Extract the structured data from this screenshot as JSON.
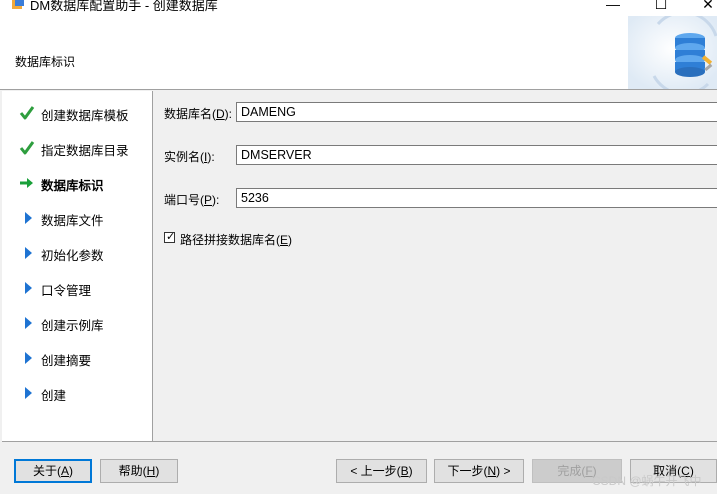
{
  "window": {
    "title": "DM数据库配置助手 - 创建数据库",
    "minimize_glyph": "—",
    "maximize_glyph": "☐",
    "close_glyph": "✕"
  },
  "header": {
    "title": "数据库标识",
    "graphic_icon": "database-stack-icon"
  },
  "nav": {
    "items": [
      {
        "label": "创建数据库模板",
        "state": "done",
        "icon": "check-icon"
      },
      {
        "label": "指定数据库目录",
        "state": "done",
        "icon": "check-icon"
      },
      {
        "label": "数据库标识",
        "state": "current",
        "icon": "arrow-right-icon"
      },
      {
        "label": "数据库文件",
        "state": "pending",
        "icon": "triangle-right-icon"
      },
      {
        "label": "初始化参数",
        "state": "pending",
        "icon": "triangle-right-icon"
      },
      {
        "label": "口令管理",
        "state": "pending",
        "icon": "triangle-right-icon"
      },
      {
        "label": "创建示例库",
        "state": "pending",
        "icon": "triangle-right-icon"
      },
      {
        "label": "创建摘要",
        "state": "pending",
        "icon": "triangle-right-icon"
      },
      {
        "label": "创建",
        "state": "pending",
        "icon": "triangle-right-icon"
      }
    ]
  },
  "form": {
    "db_name": {
      "label_pre": "数据库名(",
      "mnemonic": "D",
      "label_post": "):",
      "value": "DAMENG"
    },
    "instance_name": {
      "label_pre": "实例名(",
      "mnemonic": "I",
      "label_post": "):",
      "value": "DMSERVER"
    },
    "port": {
      "label_pre": "端口号(",
      "mnemonic": "P",
      "label_post": "):",
      "value": "5236"
    },
    "append_path": {
      "label_pre": "路径拼接数据库名(",
      "mnemonic": "E",
      "label_post": ")",
      "checked": true
    }
  },
  "buttons": {
    "about": {
      "pre": "关于(",
      "mnemonic": "A",
      "post": ")"
    },
    "help": {
      "pre": "帮助(",
      "mnemonic": "H",
      "post": ")"
    },
    "prev": {
      "pre": "< 上一步(",
      "mnemonic": "B",
      "post": ")"
    },
    "next": {
      "pre": "下一步(",
      "mnemonic": "N",
      "post": ") >"
    },
    "finish": {
      "pre": "完成(",
      "mnemonic": "F",
      "post": ")"
    },
    "cancel": {
      "pre": "取消(",
      "mnemonic": "C",
      "post": ")"
    }
  },
  "watermark": "CSDN @蜗牛开飞中",
  "colors": {
    "check": "#2e9e3e",
    "arrow": "#1aa03a",
    "triangle": "#1e73d2",
    "primary_border": "#0078d7"
  }
}
